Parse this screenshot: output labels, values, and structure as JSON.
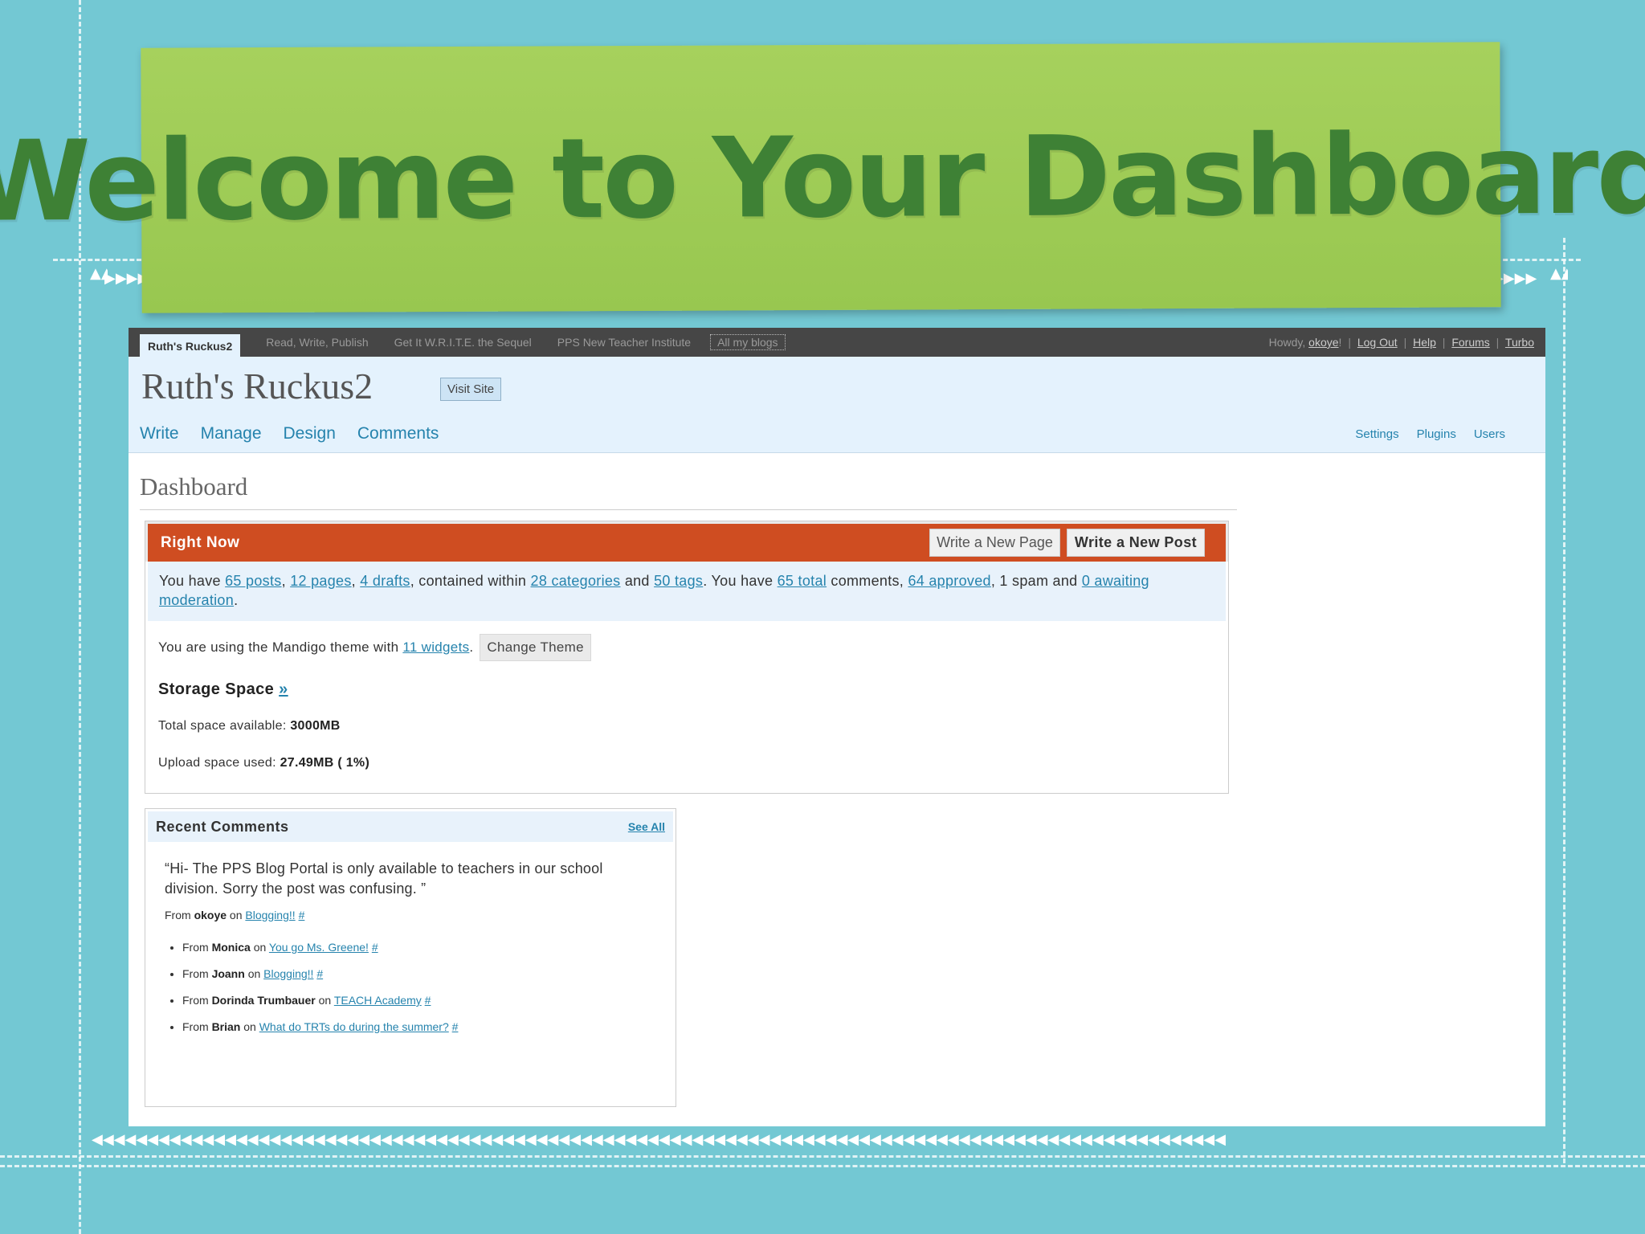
{
  "slide": {
    "title": "Welcome to Your Dashboard"
  },
  "admin_bar": {
    "current_blog": "Ruth's Ruckus2",
    "blogs": [
      "Read, Write, Publish",
      "Get It W.R.I.T.E. the Sequel",
      "PPS New Teacher Institute"
    ],
    "all_blogs": "All my blogs",
    "howdy": "Howdy,",
    "user": "okoye",
    "howdy_end": "!",
    "links": [
      "Log Out",
      "Help",
      "Forums",
      "Turbo"
    ]
  },
  "header": {
    "site_title": "Ruth's Ruckus2",
    "visit_site": "Visit Site",
    "main_menu": [
      "Write",
      "Manage",
      "Design",
      "Comments"
    ],
    "side_menu": [
      "Settings",
      "Plugins",
      "Users"
    ]
  },
  "page": {
    "title": "Dashboard"
  },
  "right_now": {
    "title": "Right Now",
    "write_page": "Write a New Page",
    "write_post": "Write a New Post",
    "summary": {
      "you_have": "You have",
      "posts": "65 posts",
      "pages": "12 pages",
      "drafts": "4 drafts",
      "contained_within": ", contained within",
      "categories": "28 categories",
      "and": "and",
      "tags": "50 tags",
      "you_have_2": ". You have",
      "total": "65 total",
      "comments": "comments,",
      "approved": "64 approved",
      "spam": ", 1 spam and",
      "awaiting": "0 awaiting moderation",
      "end": "."
    },
    "theme": {
      "text": "You are using the Mandigo theme with",
      "widgets": "11 widgets",
      "end": ".",
      "change_theme": "Change Theme"
    },
    "storage": {
      "heading": "Storage Space",
      "link": "»",
      "total_label": "Total space available:",
      "total_value": "3000MB",
      "used_label": "Upload space used:",
      "used_value": "27.49MB ( 1%)"
    }
  },
  "recent_comments": {
    "title": "Recent Comments",
    "see_all": "See All",
    "quote": "“Hi- The PPS Blog Portal is only available to teachers in our school division. Sorry the post was confusing. ”",
    "from": "From",
    "on": "on",
    "hash": "#",
    "first": {
      "author": "okoye",
      "post": "Blogging!!"
    },
    "items": [
      {
        "author": "Monica",
        "post": "You go Ms. Greene!"
      },
      {
        "author": "Joann",
        "post": "Blogging!!"
      },
      {
        "author": "Dorinda Trumbauer",
        "post": "TEACH Academy"
      },
      {
        "author": "Brian",
        "post": "What do TRTs do during the summer?"
      }
    ]
  }
}
